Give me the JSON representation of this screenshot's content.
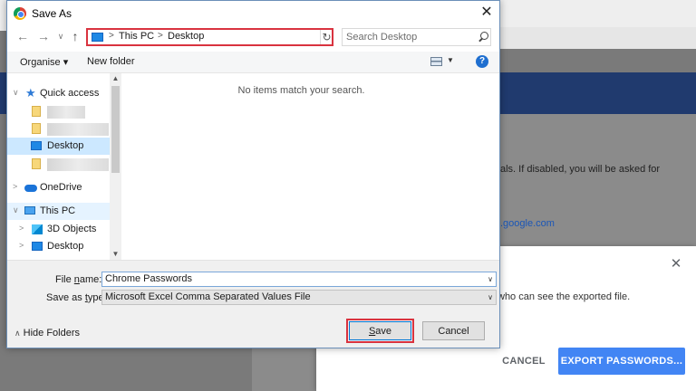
{
  "background_page": {
    "text_line1": "als. If disabled, you will be asked for",
    "link_text": ".google.com"
  },
  "chrome_dialog": {
    "description": "who can see the exported file.",
    "cancel_label": "CANCEL",
    "export_label": "EXPORT PASSWORDS..."
  },
  "save_dialog": {
    "title": "Save As",
    "breadcrumb": [
      "This PC",
      "Desktop"
    ],
    "search_placeholder": "Search Desktop",
    "toolbar": {
      "organise": "Organise ▾",
      "new_folder": "New folder"
    },
    "nav_items": [
      {
        "label": "Quick access",
        "icon": "star-icon"
      },
      {
        "label": "",
        "icon": "folder-icon"
      },
      {
        "label": "",
        "icon": "folder-icon"
      },
      {
        "label": "Desktop",
        "icon": "desktop-icon"
      },
      {
        "label": "",
        "icon": "folder-icon"
      },
      {
        "label": "OneDrive",
        "icon": "cloud-icon"
      },
      {
        "label": "This PC",
        "icon": "pc-icon"
      },
      {
        "label": "3D Objects",
        "icon": "cube-icon"
      },
      {
        "label": "Desktop",
        "icon": "desktop-icon"
      }
    ],
    "empty_message": "No items match your search.",
    "file_name_label_pre": "File ",
    "file_name_label_u": "n",
    "file_name_label_post": "ame:",
    "file_name_value": "Chrome Passwords",
    "save_type_label_pre": "Save as ",
    "save_type_label_u": "t",
    "save_type_label_post": "ype:",
    "save_type_value": "Microsoft Excel Comma Separated Values File",
    "hide_folders": "Hide Folders",
    "save_label_u": "S",
    "save_label_post": "ave",
    "cancel_label": "Cancel"
  }
}
